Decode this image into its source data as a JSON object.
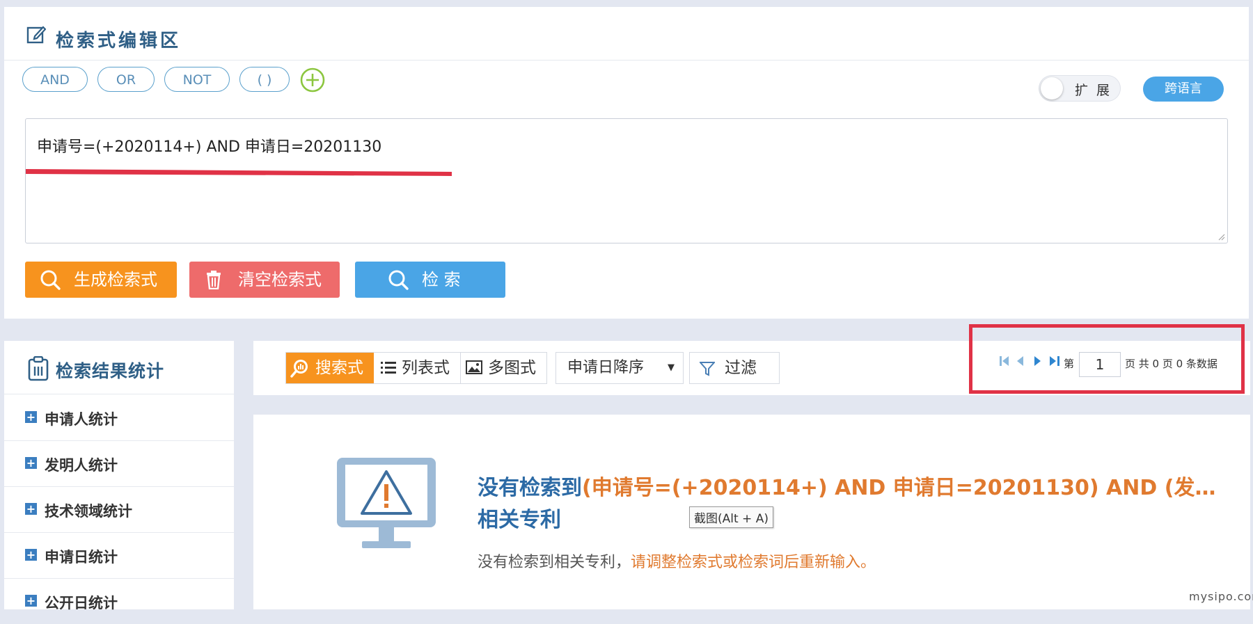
{
  "editor": {
    "title": "检索式编辑区",
    "operators": [
      "AND",
      "OR",
      "NOT",
      "( )"
    ],
    "expand_label": "扩 展",
    "cross_language_label": "跨语言",
    "query_text": "申请号=(+2020114+) AND 申请日=20201130",
    "generate_label": "生成检索式",
    "clear_label": "清空检索式",
    "search_label": "检 索"
  },
  "stats": {
    "title": "检索结果统计",
    "items": [
      "申请人统计",
      "发明人统计",
      "技术领域统计",
      "申请日统计",
      "公开日统计"
    ]
  },
  "toolbar": {
    "views": [
      "搜索式",
      "列表式",
      "多图式"
    ],
    "sort_label": "申请日降序",
    "filter_label": "过滤"
  },
  "pager": {
    "prefix": "第",
    "current_page": "1",
    "suffix": "页 共 0 页 0 条数据"
  },
  "results": {
    "no_result_prefix": "没有检索到",
    "no_result_query": "(申请号=(+2020114+) AND 申请日=20201130) AND (发…",
    "no_result_suffix": "相关专利",
    "hint_prefix": "没有检索到相关专利，",
    "hint_action": "请调整检索式或检索词后重新输入。"
  },
  "tooltip": "截图(Alt + A)",
  "watermark": "mysipo.com",
  "colors": {
    "accent_blue": "#4aa5e6",
    "generate_orange": "#f7931e",
    "clear_red": "#ee6b6b",
    "highlight_red": "#e03246",
    "title_blue": "#2f5f86"
  }
}
